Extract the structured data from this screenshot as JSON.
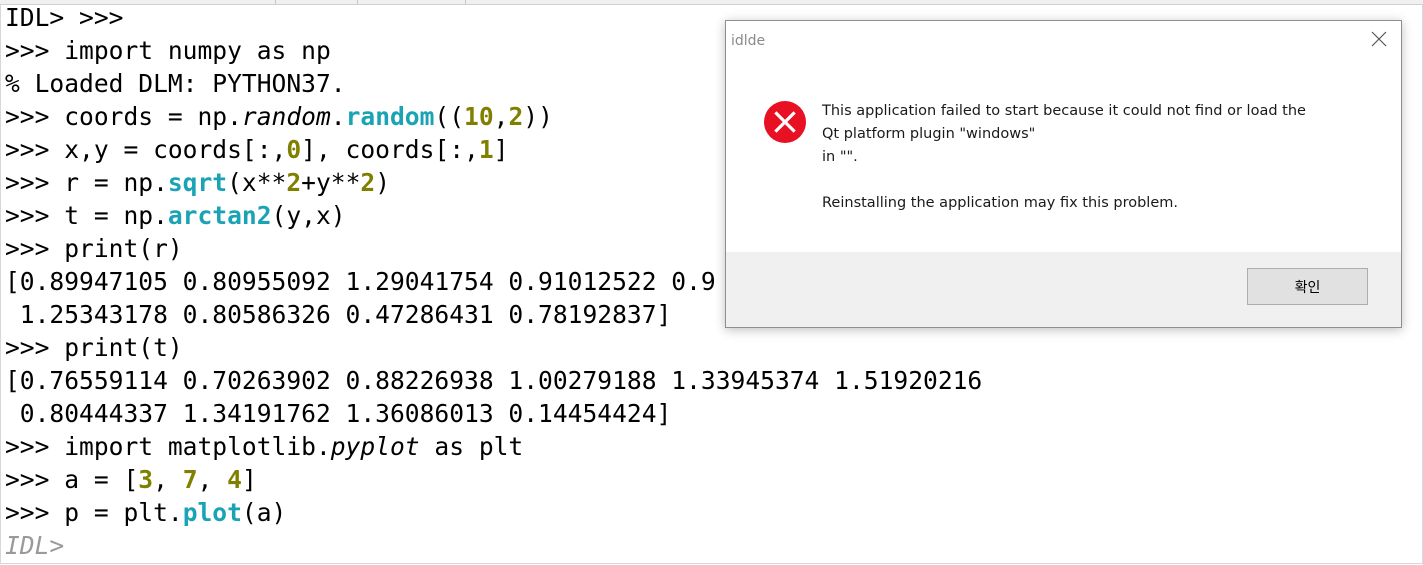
{
  "console": {
    "lines": [
      [
        {
          "t": "IDL> >>>"
        }
      ],
      [
        {
          "t": ">>> import numpy as np"
        }
      ],
      [
        {
          "t": "% Loaded DLM: PYTHON37."
        }
      ],
      [
        {
          "t": ">>> coords = np."
        },
        {
          "t": "random",
          "c": "it"
        },
        {
          "t": "."
        },
        {
          "t": "random",
          "c": "fn"
        },
        {
          "t": "(("
        },
        {
          "t": "10",
          "c": "num"
        },
        {
          "t": ","
        },
        {
          "t": "2",
          "c": "num"
        },
        {
          "t": "))"
        }
      ],
      [
        {
          "t": ">>> x,y = coords[:,"
        },
        {
          "t": "0",
          "c": "num"
        },
        {
          "t": "], coords[:,"
        },
        {
          "t": "1",
          "c": "num"
        },
        {
          "t": "]"
        }
      ],
      [
        {
          "t": ">>> r = np."
        },
        {
          "t": "sqrt",
          "c": "fn"
        },
        {
          "t": "(x**"
        },
        {
          "t": "2",
          "c": "num"
        },
        {
          "t": "+y**"
        },
        {
          "t": "2",
          "c": "num"
        },
        {
          "t": ")"
        }
      ],
      [
        {
          "t": ">>> t = np."
        },
        {
          "t": "arctan2",
          "c": "fn"
        },
        {
          "t": "(y,x)"
        }
      ],
      [
        {
          "t": ">>> print(r)"
        }
      ],
      [
        {
          "t": "[0.89947105 0.80955092 1.29041754 0.91012522 0.9"
        }
      ],
      [
        {
          "t": " 1.25343178 0.80586326 0.47286431 0.78192837]"
        }
      ],
      [
        {
          "t": ">>> print(t)"
        }
      ],
      [
        {
          "t": "[0.76559114 0.70263902 0.88226938 1.00279188 1.33945374 1.51920216"
        }
      ],
      [
        {
          "t": " 0.80444337 1.34191762 1.36086013 0.14454424]"
        }
      ],
      [
        {
          "t": ">>> import matplotlib."
        },
        {
          "t": "pyplot",
          "c": "it"
        },
        {
          "t": " as plt"
        }
      ],
      [
        {
          "t": ">>> a = ["
        },
        {
          "t": "3",
          "c": "num"
        },
        {
          "t": ", "
        },
        {
          "t": "7",
          "c": "num"
        },
        {
          "t": ", "
        },
        {
          "t": "4",
          "c": "num"
        },
        {
          "t": "]"
        }
      ],
      [
        {
          "t": ">>> p = plt."
        },
        {
          "t": "plot",
          "c": "fn"
        },
        {
          "t": "(a)"
        }
      ],
      [
        {
          "t": "IDL>",
          "c": "prompt-gray"
        }
      ]
    ]
  },
  "dialog": {
    "title": "idlde",
    "message_line1": "This application failed to start because it could not find or load the",
    "message_line2": "Qt platform plugin \"windows\"",
    "message_line3": "in \"\".",
    "message_line4": "Reinstalling the application may fix this problem.",
    "ok_label": "확인",
    "close_icon": "close-icon",
    "error_icon": "error-icon",
    "error_color": "#e81123"
  }
}
